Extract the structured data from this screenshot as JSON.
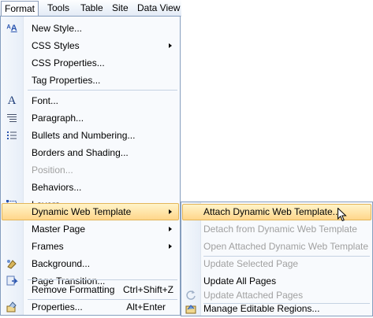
{
  "menubar": {
    "items": [
      {
        "label": "Format"
      },
      {
        "label": "Tools"
      },
      {
        "label": "Table"
      },
      {
        "label": "Site"
      },
      {
        "label": "Data View"
      }
    ]
  },
  "format_menu": {
    "items": [
      {
        "label": "New Style..."
      },
      {
        "label": "CSS Styles"
      },
      {
        "label": "CSS Properties..."
      },
      {
        "label": "Tag Properties..."
      },
      {
        "label": "Font..."
      },
      {
        "label": "Paragraph..."
      },
      {
        "label": "Bullets and Numbering..."
      },
      {
        "label": "Borders and Shading..."
      },
      {
        "label": "Position..."
      },
      {
        "label": "Behaviors..."
      },
      {
        "label": "Layers..."
      },
      {
        "label": "Dynamic Web Template"
      },
      {
        "label": "Master Page"
      },
      {
        "label": "Frames"
      },
      {
        "label": "Background..."
      },
      {
        "label": "Page Transition..."
      },
      {
        "label": "Remove Formatting",
        "shortcut": "Ctrl+Shift+Z"
      },
      {
        "label": "Properties...",
        "shortcut": "Alt+Enter"
      }
    ]
  },
  "dwt_submenu": {
    "items": [
      {
        "label": "Attach Dynamic Web Template..."
      },
      {
        "label": "Detach from Dynamic Web Template"
      },
      {
        "label": "Open Attached Dynamic Web Template"
      },
      {
        "label": "Update Selected Page"
      },
      {
        "label": "Update All Pages"
      },
      {
        "label": "Update Attached Pages"
      },
      {
        "label": "Manage Editable Regions..."
      }
    ]
  },
  "colors": {
    "highlight_top": "#fff4c9",
    "highlight_bottom": "#ffd68a",
    "menu_border": "#869ebe",
    "disabled_text": "#a0a0a0"
  }
}
